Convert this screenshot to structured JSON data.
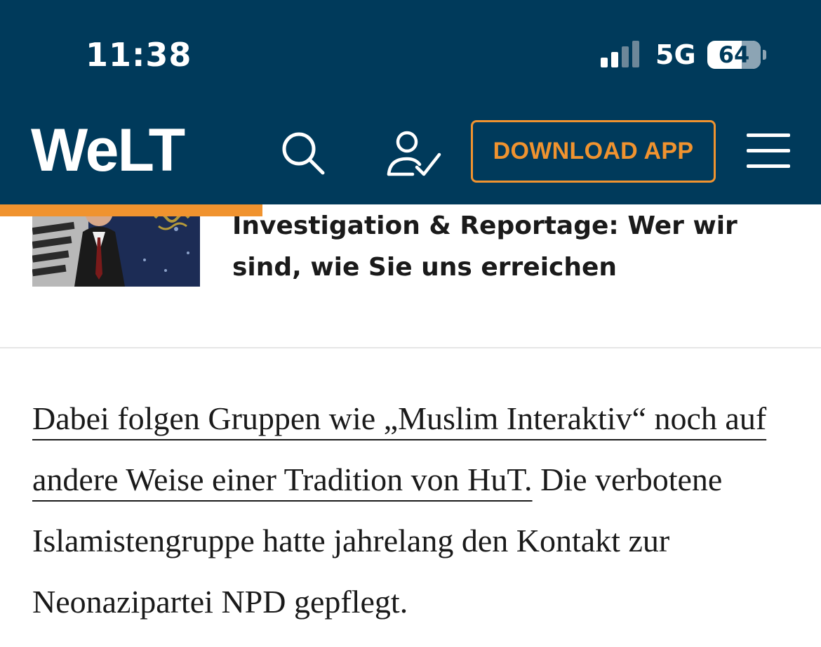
{
  "status_bar": {
    "time": "11:38",
    "network": "5G",
    "battery_level": "64",
    "battery_fraction": 0.64,
    "signal_bars_active": 2,
    "signal_bars_total": 4
  },
  "header": {
    "logo": "WELT",
    "logo_parts": [
      "W",
      "e",
      "LT"
    ],
    "download_label": "DOWNLOAD APP",
    "icons": {
      "search": "search-icon",
      "login": "user-check-icon",
      "menu": "hamburger-menu-icon"
    }
  },
  "reading_progress": 0.32,
  "related_teaser": {
    "title": "Investigation & Reportage: Wer wir sind, wie Sie uns erreichen"
  },
  "article": {
    "link_text": "Dabei folgen Gruppen wie „Muslim Interaktiv“ noch auf andere Weise einer Tradition von HuT.",
    "text": " Die verbotene Islamistengruppe hatte jahrelang den Kontakt zur Neonazipartei NPD gepflegt."
  },
  "colors": {
    "header_bg": "#003a5b",
    "accent": "#f0932f",
    "text": "#1a1a1a",
    "divider": "#e6e6e6"
  }
}
